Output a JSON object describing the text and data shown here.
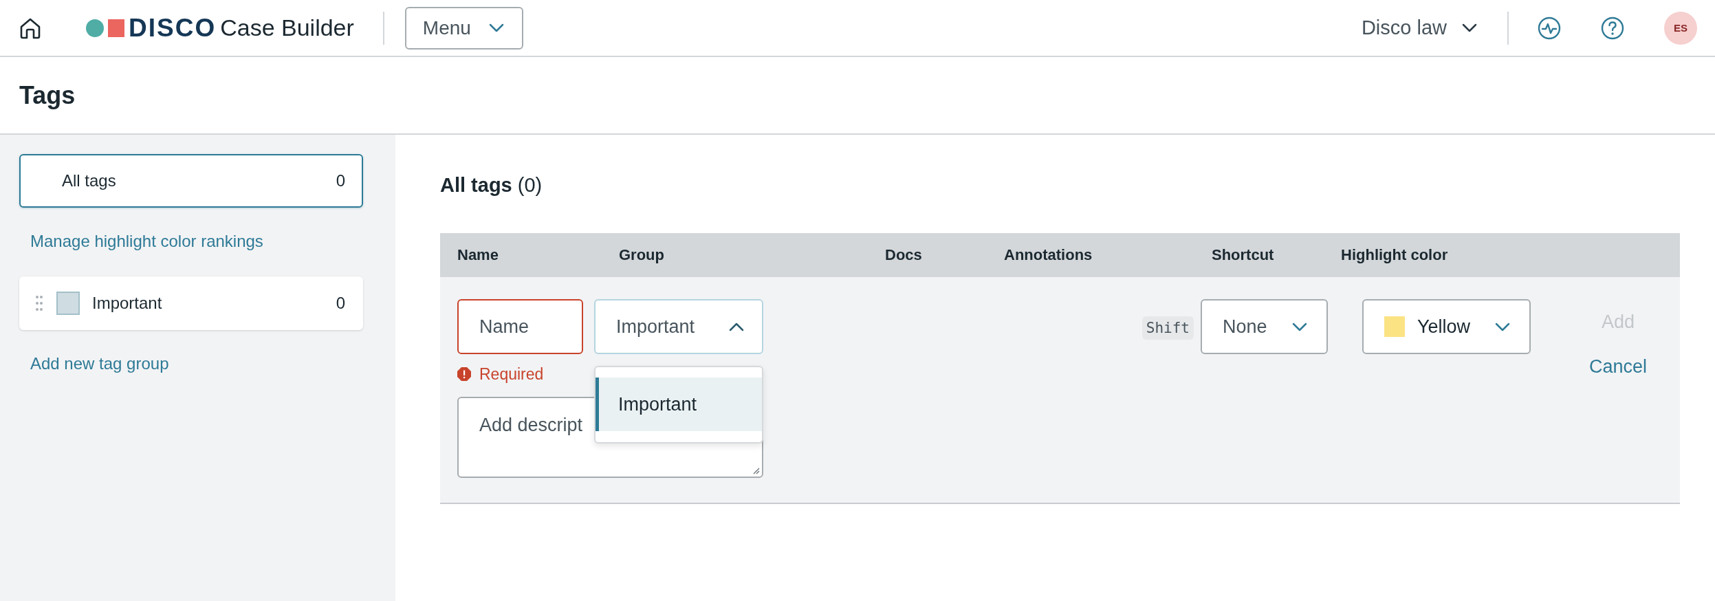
{
  "header": {
    "brand": "DISCO",
    "product": "Case Builder",
    "menu_button": "Menu",
    "workspace": "Disco law",
    "avatar_initials": "ES"
  },
  "page_title": "Tags",
  "sidebar": {
    "items": [
      {
        "kind": "filter",
        "label": "All tags",
        "count": "0",
        "selected": true
      },
      {
        "kind": "link",
        "label": "Manage highlight color rankings"
      },
      {
        "kind": "group",
        "label": "Important",
        "count": "0",
        "color": "#cfdde2",
        "selected": false
      },
      {
        "kind": "link",
        "label": "Add new tag group"
      }
    ]
  },
  "main": {
    "heading": "All tags",
    "heading_count": "(0)",
    "table": {
      "columns": [
        "Name",
        "Group",
        "Docs",
        "Annotations",
        "Shortcut",
        "Highlight color"
      ]
    },
    "new_tag_form": {
      "name": {
        "placeholder": "Name",
        "invalid": true,
        "error": "Required"
      },
      "group": {
        "value": "Important",
        "expanded": true,
        "options": [
          {
            "label": "Important",
            "selected": true
          }
        ]
      },
      "description": {
        "placeholder": "Add descript"
      },
      "shortcut": {
        "modifier": "Shift",
        "value": "None"
      },
      "highlight_color": {
        "value": "Yellow",
        "color": "#fbe384"
      },
      "add_button": {
        "label": "Add",
        "disabled": true
      },
      "cancel_button": {
        "label": "Cancel"
      }
    }
  }
}
